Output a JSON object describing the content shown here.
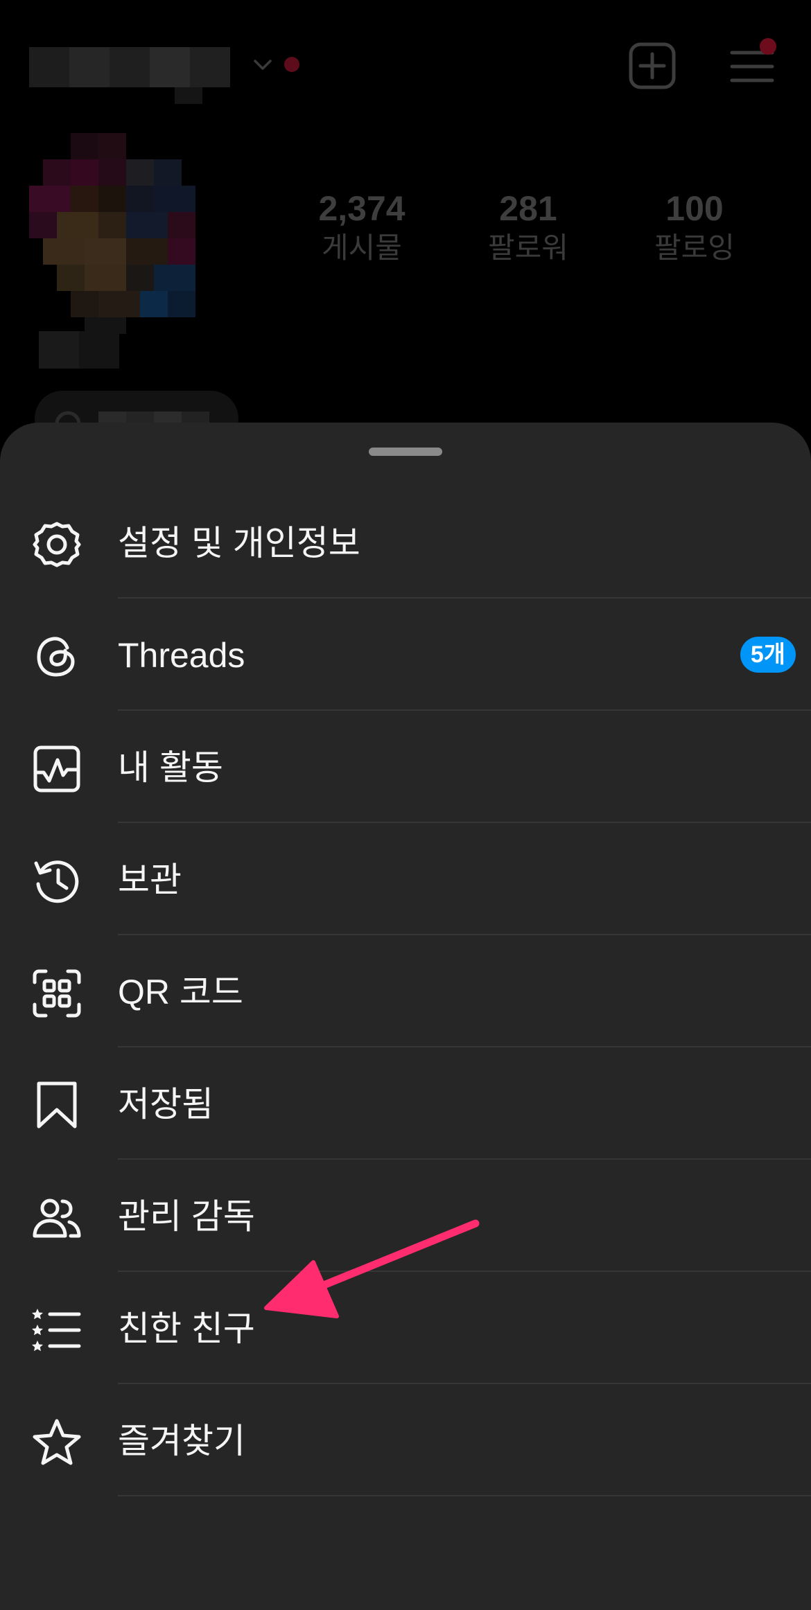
{
  "profile": {
    "stats": [
      {
        "value": "2,374",
        "label": "게시물"
      },
      {
        "value": "281",
        "label": "팔로워"
      },
      {
        "value": "100",
        "label": "팔로잉"
      }
    ]
  },
  "menu": {
    "items": [
      {
        "label": "설정 및 개인정보",
        "icon": "settings-gear-icon"
      },
      {
        "label": "Threads",
        "icon": "threads-icon",
        "badge": "5개"
      },
      {
        "label": "내 활동",
        "icon": "activity-icon"
      },
      {
        "label": "보관",
        "icon": "archive-clock-icon"
      },
      {
        "label": "QR 코드",
        "icon": "qr-code-icon"
      },
      {
        "label": "저장됨",
        "icon": "bookmark-icon"
      },
      {
        "label": "관리 감독",
        "icon": "supervision-people-icon"
      },
      {
        "label": "친한 친구",
        "icon": "close-friends-list-icon"
      },
      {
        "label": "즐겨찾기",
        "icon": "star-icon"
      }
    ]
  },
  "colors": {
    "sheet_bg": "#262626",
    "badge_bg": "#0095f6",
    "annotation_arrow": "#ff2d6f",
    "notification_dot": "#ff3040"
  }
}
